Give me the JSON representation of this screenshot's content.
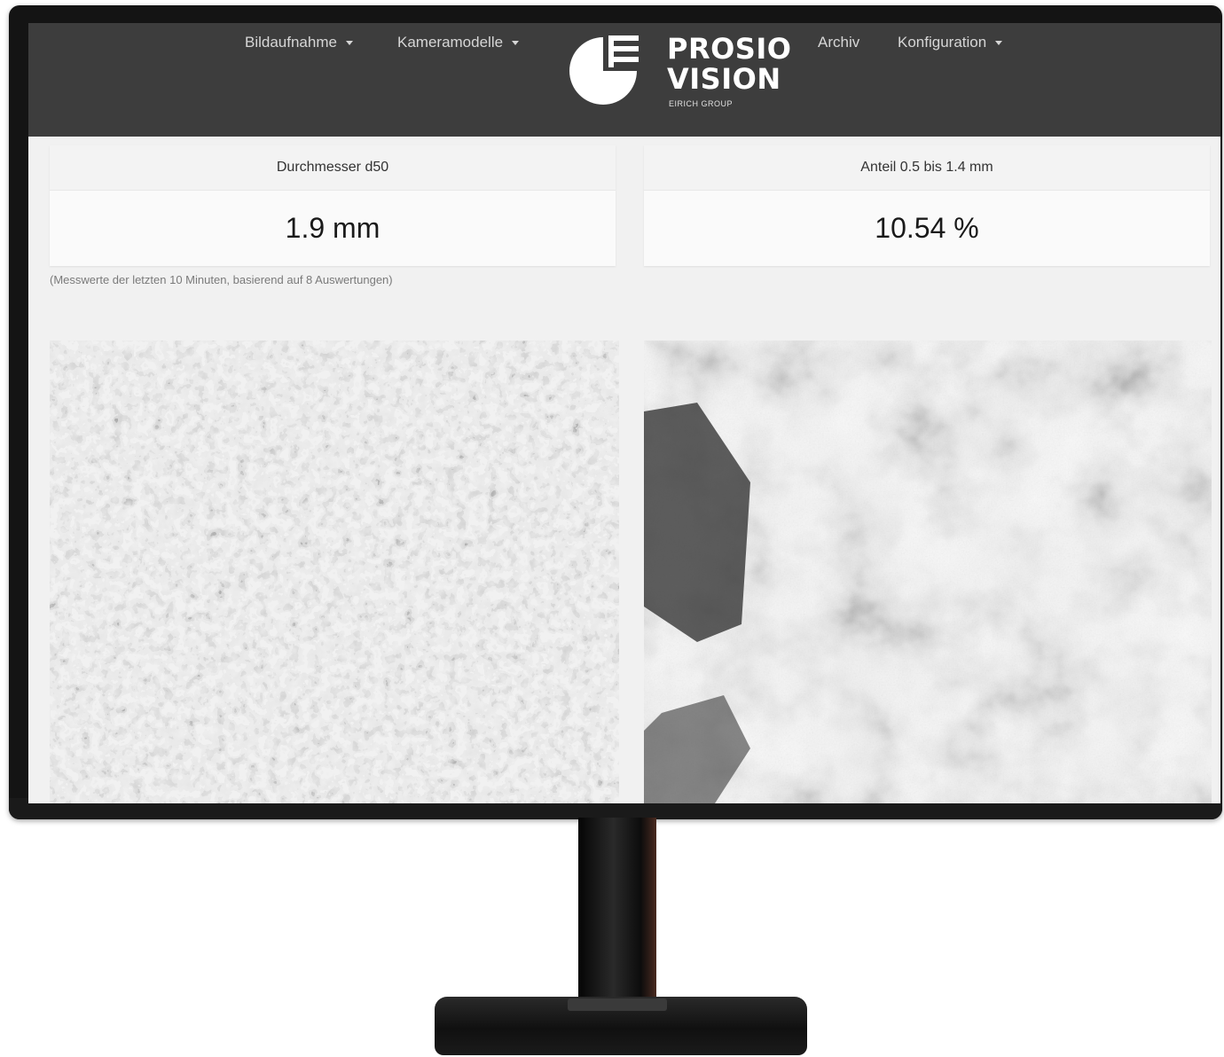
{
  "navbar": {
    "items": [
      {
        "label": "Bildaufnahme",
        "dropdown": true
      },
      {
        "label": "Kameramodelle",
        "dropdown": true
      },
      {
        "label": "Archiv",
        "dropdown": false
      },
      {
        "label": "Konfiguration",
        "dropdown": true
      }
    ],
    "logo": {
      "line1": "PROSIO",
      "line2": "VISION",
      "sub": "EIRICH GROUP"
    }
  },
  "metrics": [
    {
      "title": "Durchmesser d50",
      "value": "1.9 mm"
    },
    {
      "title": "Anteil 0.5 bis 1.4 mm",
      "value": "10.54 %"
    }
  ],
  "note": "(Messwerte der letzten 10 Minuten, basierend auf 8 Auswertungen)",
  "colors": {
    "navbar_bg": "#3d3d3d",
    "page_bg": "#f1f1f1",
    "monitor_frame": "#141414"
  },
  "images": [
    {
      "name": "fine-granulate-image",
      "style": "grayscale"
    },
    {
      "name": "coarse-granulate-image",
      "style": "grayscale"
    }
  ]
}
